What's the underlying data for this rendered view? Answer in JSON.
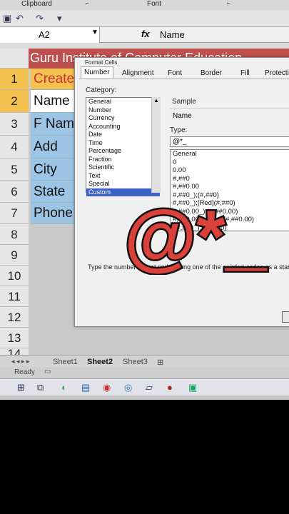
{
  "ribbon": {
    "left_label": "Clipboard",
    "center_label": "Font"
  },
  "formula_bar": {
    "name_box": "A2",
    "fx": "fx",
    "value": "Name"
  },
  "sheet": {
    "banner": "Guru Institute of Computer Education",
    "rows": [
      {
        "num": "1",
        "text": "Create"
      },
      {
        "num": "2",
        "text": "Name"
      },
      {
        "num": "3",
        "text": "F Nam"
      },
      {
        "num": "4",
        "text": "Add"
      },
      {
        "num": "5",
        "text": "City"
      },
      {
        "num": "6",
        "text": "State"
      },
      {
        "num": "7",
        "text": "Phone"
      },
      {
        "num": "8",
        "text": ""
      },
      {
        "num": "9",
        "text": ""
      },
      {
        "num": "10",
        "text": ""
      },
      {
        "num": "11",
        "text": ""
      },
      {
        "num": "12",
        "text": ""
      },
      {
        "num": "13",
        "text": ""
      },
      {
        "num": "14",
        "text": ""
      }
    ],
    "tabs": [
      "Sheet1",
      "Sheet2",
      "Sheet3"
    ],
    "status": "Ready"
  },
  "dialog": {
    "title": "Format Cells",
    "tabs": [
      "Number",
      "Alignment",
      "Font",
      "Border",
      "Fill",
      "Protection"
    ],
    "category_label": "Category:",
    "categories": [
      "General",
      "Number",
      "Currency",
      "Accounting",
      "Date",
      "Time",
      "Percentage",
      "Fraction",
      "Scientific",
      "Text",
      "Special",
      "Custom"
    ],
    "selected_category": "Custom",
    "sample_label": "Sample",
    "sample_value": "Name",
    "type_label": "Type:",
    "type_value": "@*_",
    "types": [
      "General",
      "0",
      "0.00",
      "#,##0",
      "#,##0.00",
      "#,##0_);(#,##0)",
      "#,##0_);[Red](#,##0)",
      "#,##0.00_);(#,##0.00)",
      "#,##0.00_);[Red](#,##0.00)",
      "$#,##0_);($#,##0)"
    ],
    "help_text": "Type the number format code, using one of the existing codes as a starting point."
  },
  "overlay_text": "@*_",
  "colors": {
    "banner": "#c0504d",
    "yellow": "#f2c14f",
    "blue": "#9cc4e4",
    "selection": "#3a62c8"
  }
}
